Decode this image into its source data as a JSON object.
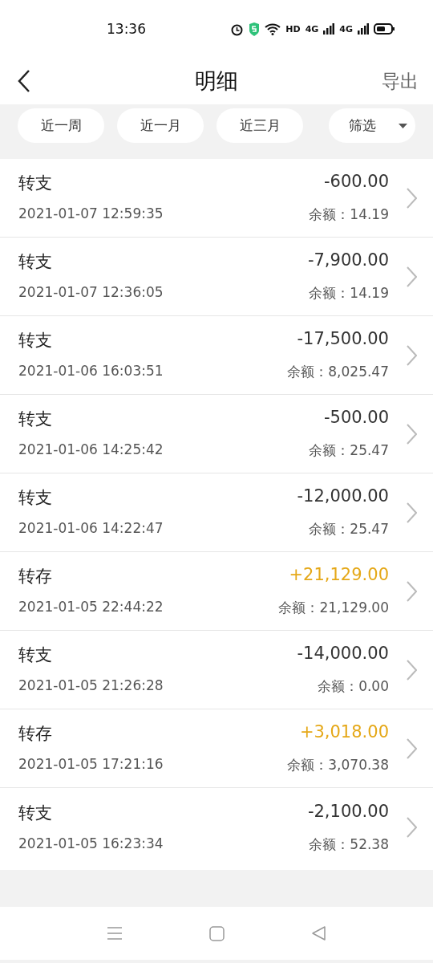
{
  "status_bar": {
    "time": "13:36",
    "network_labels": [
      "HD",
      "4G",
      "4G"
    ]
  },
  "header": {
    "title": "明细",
    "action": "导出"
  },
  "filters": [
    {
      "label": "近一周",
      "kind": "chip"
    },
    {
      "label": "近一月",
      "kind": "chip"
    },
    {
      "label": "近三月",
      "kind": "chip"
    },
    {
      "label": "筛选",
      "kind": "dropdown"
    }
  ],
  "transactions": [
    {
      "type": "转支",
      "kind": "debit",
      "amount": "-600.00",
      "time": "2021-01-07 12:59:35",
      "balance": "余额：14.19"
    },
    {
      "type": "转支",
      "kind": "debit",
      "amount": "-7,900.00",
      "time": "2021-01-07 12:36:05",
      "balance": "余额：14.19"
    },
    {
      "type": "转支",
      "kind": "debit",
      "amount": "-17,500.00",
      "time": "2021-01-06 16:03:51",
      "balance": "余额：8,025.47"
    },
    {
      "type": "转支",
      "kind": "debit",
      "amount": "-500.00",
      "time": "2021-01-06 14:25:42",
      "balance": "余额：25.47"
    },
    {
      "type": "转支",
      "kind": "debit",
      "amount": "-12,000.00",
      "time": "2021-01-06 14:22:47",
      "balance": "余额：25.47"
    },
    {
      "type": "转存",
      "kind": "credit",
      "amount": "+21,129.00",
      "time": "2021-01-05 22:44:22",
      "balance": "余额：21,129.00"
    },
    {
      "type": "转支",
      "kind": "debit",
      "amount": "-14,000.00",
      "time": "2021-01-05 21:26:28",
      "balance": "余额：0.00"
    },
    {
      "type": "转存",
      "kind": "credit",
      "amount": "+3,018.00",
      "time": "2021-01-05 17:21:16",
      "balance": "余额：3,070.38"
    },
    {
      "type": "转支",
      "kind": "debit",
      "amount": "-2,100.00",
      "time": "2021-01-05 16:23:34",
      "balance": "余额：52.38"
    }
  ]
}
